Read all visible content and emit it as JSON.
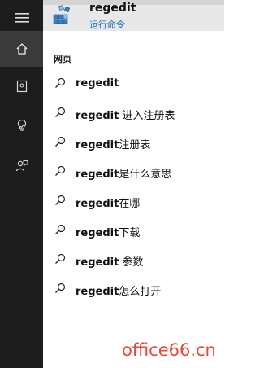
{
  "best_match": {
    "title": "regedit",
    "subtitle": "运行命令",
    "icon": "regedit-app-icon"
  },
  "section": {
    "label": "网页"
  },
  "rail": {
    "items": [
      {
        "icon": "hamburger-menu-icon"
      },
      {
        "icon": "home-icon"
      },
      {
        "icon": "notebook-icon"
      },
      {
        "icon": "lightbulb-icon"
      },
      {
        "icon": "feedback-icon"
      }
    ]
  },
  "suggestions": [
    {
      "bold": "regedit",
      "rest": ""
    },
    {
      "bold": "regedit",
      "rest": " 进入注册表"
    },
    {
      "bold": "regedit",
      "rest": "注册表"
    },
    {
      "bold": "regedit",
      "rest": "是什么意思"
    },
    {
      "bold": "regedit",
      "rest": "在哪"
    },
    {
      "bold": "regedit",
      "rest": "下载"
    },
    {
      "bold": "regedit",
      "rest": " 参数"
    },
    {
      "bold": "regedit",
      "rest": "怎么打开"
    }
  ],
  "watermark": "office66.cn",
  "colors": {
    "rail_bg": "#1d1d1d",
    "accent_link": "#1a6cb5",
    "watermark": "#e24a3b"
  }
}
